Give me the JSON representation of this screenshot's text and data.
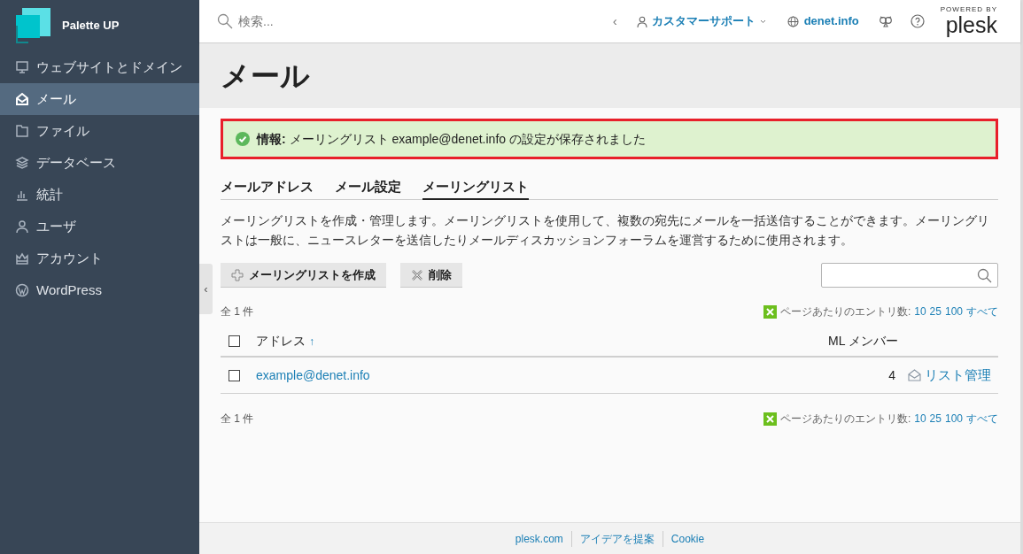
{
  "sidebar": {
    "brand": "Palette UP",
    "items": [
      {
        "label": "ウェブサイトとドメイン",
        "selected": false
      },
      {
        "label": "メール",
        "selected": true
      },
      {
        "label": "ファイル",
        "selected": false
      },
      {
        "label": "データベース",
        "selected": false
      },
      {
        "label": "統計",
        "selected": false
      },
      {
        "label": "ユーザ",
        "selected": false
      },
      {
        "label": "アカウント",
        "selected": false
      },
      {
        "label": "WordPress",
        "selected": false
      }
    ],
    "collapse": "‹"
  },
  "header": {
    "search_placeholder": "検索...",
    "back": "‹",
    "user": "カスタマーサポート",
    "domain": "denet.info",
    "powered_by": "POWERED BY",
    "brand": "plesk"
  },
  "page_title": "メール",
  "message": {
    "text": "**情報:** メーリングリスト example@denet.info の設定が保存されました"
  },
  "tabs": [
    {
      "label": "メールアドレス",
      "selected": false
    },
    {
      "label": "メール設定",
      "selected": false
    },
    {
      "label": "メーリングリスト",
      "selected": true
    }
  ],
  "description": "メーリングリストを作成・管理します。メーリングリストを使用して、複数の宛先にメールを一括送信することができます。メーリングリストは一般に、ニュースレターを送信したりメールディスカッションフォーラムを運営するために使用されます。",
  "toolbar": {
    "buttons": [
      {
        "label": "メーリングリストを作成",
        "kind": "add"
      },
      {
        "label": "削除",
        "kind": "delete"
      }
    ]
  },
  "total_top": "全 1 件",
  "total_bottom": "全 1 件",
  "pagination_top": {
    "label": "ページあたりのエントリ数:",
    "options": [
      "10",
      "25",
      "100",
      "すべて"
    ]
  },
  "pagination_bottom": {
    "label": "ページあたりのエントリ数:",
    "options": [
      "10",
      "25",
      "100",
      "すべて"
    ]
  },
  "table": {
    "columns": [
      "アドレス",
      "ML メンバー"
    ],
    "sort_mark": "↑",
    "select_all_checked": false,
    "rows": [
      {
        "address": "example@denet.info",
        "members": "4",
        "action": "リスト管理",
        "checked": false
      }
    ]
  },
  "footer": {
    "links": [
      "plesk.com",
      "アイデアを提案",
      "Cookie"
    ]
  }
}
